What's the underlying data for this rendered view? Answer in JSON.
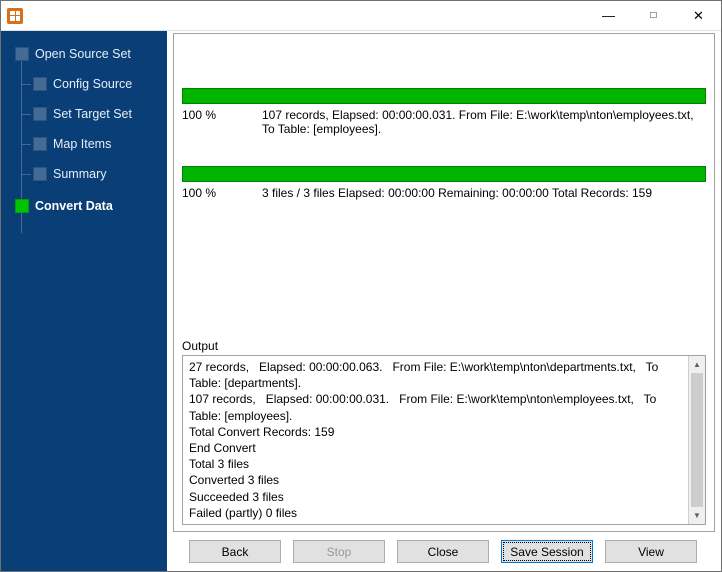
{
  "titlebar": {
    "title": ""
  },
  "sidebar": {
    "items": [
      {
        "label": "Open Source Set",
        "active": false
      },
      {
        "label": "Config Source",
        "active": false
      },
      {
        "label": "Set Target Set",
        "active": false
      },
      {
        "label": "Map Items",
        "active": false
      },
      {
        "label": "Summary",
        "active": false
      },
      {
        "label": "Convert Data",
        "active": true
      }
    ]
  },
  "progress1": {
    "percent": "100 %",
    "line1": "107 records,   Elapsed: 00:00:00.031.   From File: E:\\work\\temp\\nton\\employees.txt,",
    "line2": "To Table: [employees]."
  },
  "progress2": {
    "percent": "100 %",
    "line1": "3 files / 3 files   Elapsed: 00:00:00   Remaining: 00:00:00   Total Records: 159"
  },
  "output": {
    "label": "Output",
    "text": "27 records,   Elapsed: 00:00:00.063.   From File: E:\\work\\temp\\nton\\departments.txt,   To Table: [departments].\n107 records,   Elapsed: 00:00:00.031.   From File: E:\\work\\temp\\nton\\employees.txt,   To Table: [employees].\nTotal Convert Records: 159\nEnd Convert\nTotal 3 files\nConverted 3 files\nSucceeded 3 files\nFailed (partly) 0 files"
  },
  "buttons": {
    "back": "Back",
    "stop": "Stop",
    "close": "Close",
    "save": "Save Session",
    "view": "View"
  }
}
